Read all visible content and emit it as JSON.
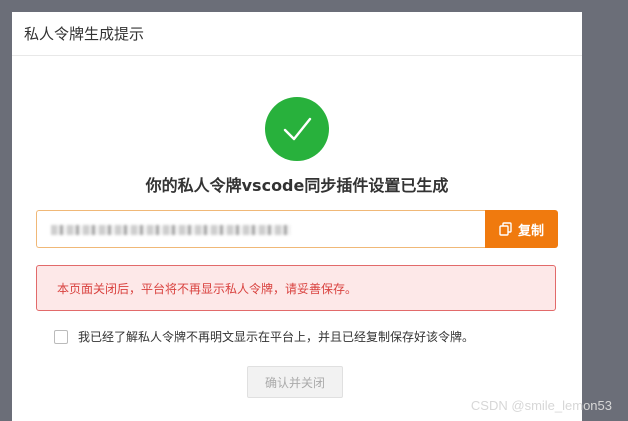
{
  "modal": {
    "title": "私人令牌生成提示",
    "headline": "你的私人令牌vscode同步插件设置已生成",
    "copy_label": "复制",
    "warning": "本页面关闭后，平台将不再显示私人令牌，请妥善保存。",
    "agree_label": "我已经了解私人令牌不再明文显示在平台上，并且已经复制保存好该令牌。",
    "confirm_label": "确认并关闭"
  },
  "watermark": "CSDN @smile_lemon53",
  "icons": {
    "success": "check-circle-icon",
    "copy": "copy-icon"
  },
  "colors": {
    "success": "#28b13c",
    "accent": "#f07a0e",
    "warning_text": "#d9423f",
    "warning_bg": "#fde8e8"
  }
}
